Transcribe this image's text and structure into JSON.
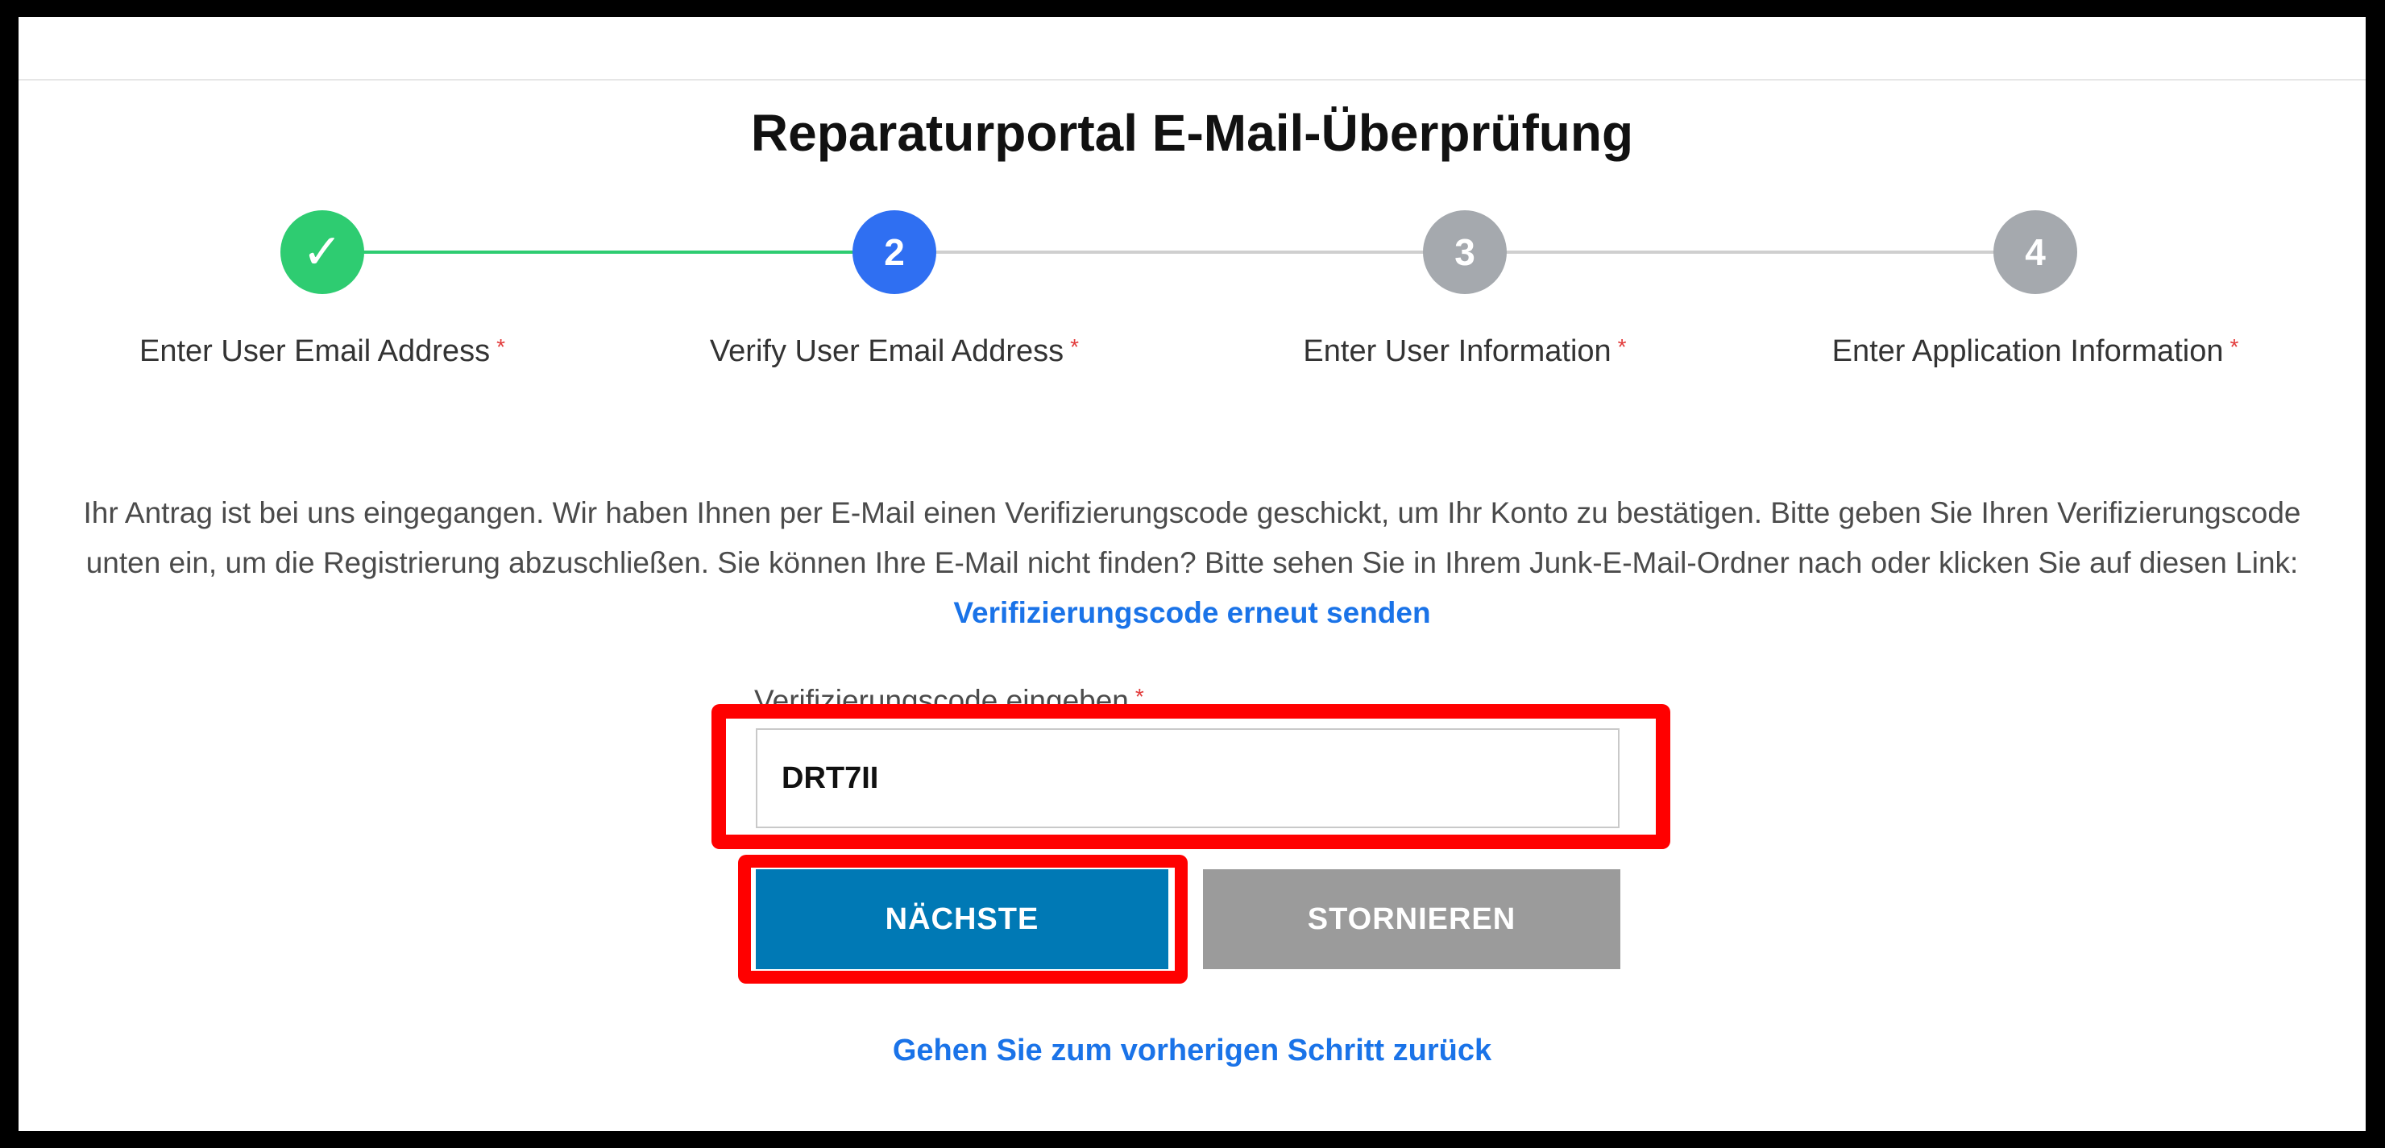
{
  "page": {
    "title": "Reparaturportal E-Mail-Überprüfung"
  },
  "stepper": {
    "steps": [
      {
        "number": "✓",
        "label": "Enter User Email Address",
        "state": "done"
      },
      {
        "number": "2",
        "label": "Verify User Email Address",
        "state": "active"
      },
      {
        "number": "3",
        "label": "Enter User Information",
        "state": "todo"
      },
      {
        "number": "4",
        "label": "Enter Application Information",
        "state": "todo"
      }
    ],
    "required_marker": "*"
  },
  "instructions": {
    "text": "Ihr Antrag ist bei uns eingegangen. Wir haben Ihnen per E-Mail einen Verifizierungscode geschickt, um Ihr Konto zu bestätigen. Bitte geben Sie Ihren Verifizierungscode unten ein, um die Registrierung abzuschließen. Sie können Ihre E-Mail nicht finden? Bitte sehen Sie in Ihrem Junk-E-Mail-Ordner nach oder klicken Sie auf diesen Link:",
    "resend_link": "Verifizierungscode erneut senden"
  },
  "form": {
    "code_label": "Verifizierungscode eingeben",
    "code_value": "DRT7II",
    "next_button": "NÄCHSTE",
    "cancel_button": "STORNIEREN",
    "back_link": "Gehen Sie zum vorherigen Schritt zurück"
  },
  "colors": {
    "step_done": "#2ecc71",
    "step_active": "#2f6ff2",
    "step_todo": "#a5a9ae",
    "next_button": "#0079b5",
    "cancel_button": "#9b9b9b",
    "link": "#1a73e8",
    "annotation_highlight": "#ff0000"
  }
}
